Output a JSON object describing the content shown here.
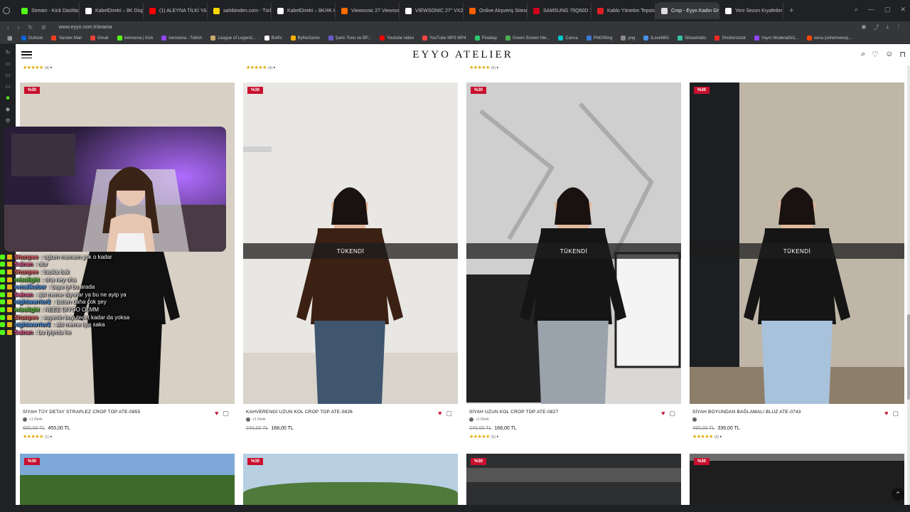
{
  "browser": {
    "tabs": [
      {
        "label": "Stream - Kick Dashboard",
        "color": "#53fc18"
      },
      {
        "label": "KabelDirekt – 8K DisplayP",
        "color": "#ffffff"
      },
      {
        "label": "(1) ALEYNA TİLKİ YALAN",
        "color": "#ff0000"
      },
      {
        "label": "sahibinden.com - Türkiye",
        "color": "#ffd800"
      },
      {
        "label": "KabelDirekt – 8K/4K HDMI",
        "color": "#ffffff"
      },
      {
        "label": "Viewsonic 27 Viewsonic",
        "color": "#ff6a00"
      },
      {
        "label": "VIEWSONIC 27\" VX2758",
        "color": "#ffffff"
      },
      {
        "label": "Online Alışveriş Sitesi, Tü",
        "color": "#ff6000"
      },
      {
        "label": "SAMSUNG 75Q60D 75 in",
        "color": "#d0021b"
      },
      {
        "label": "Kablo Yönetim Tepsisi M",
        "color": "#e01f26"
      },
      {
        "label": "Crop - Eyyo Kadın Giyim",
        "color": "#dddddd"
      },
      {
        "label": "Yeni Sezon Kıyafetler | Se",
        "color": "#ffffff"
      }
    ],
    "url": "www.eyyo.com.tr/arama",
    "bookmarks": [
      {
        "label": "Outlook",
        "color": "#0a64d6"
      },
      {
        "label": "Yandex Mail",
        "color": "#fc3f1d"
      },
      {
        "label": "Gmail",
        "color": "#ea4335"
      },
      {
        "label": "iremxena | Kick",
        "color": "#53fc18"
      },
      {
        "label": "iremxena - Twitch",
        "color": "#9146ff"
      },
      {
        "label": "League of Legend...",
        "color": "#c8aa6e"
      },
      {
        "label": "Botfix",
        "color": "#ffffff"
      },
      {
        "label": "ByNoGame",
        "color": "#ffb000"
      },
      {
        "label": "Şarkı Tonu ve BP...",
        "color": "#6a5acd"
      },
      {
        "label": "Youtube video",
        "color": "#ff0000"
      },
      {
        "label": "YouTube MP3 MP4",
        "color": "#ff4444"
      },
      {
        "label": "Pixabay",
        "color": "#2ec66d"
      },
      {
        "label": "Green Screen Me...",
        "color": "#4caf50"
      },
      {
        "label": "Canva",
        "color": "#00c4cc"
      },
      {
        "label": "PNGWing",
        "color": "#3a7bd5"
      },
      {
        "label": "png",
        "color": "#888888"
      },
      {
        "label": "iLoveIMG",
        "color": "#4a90e2"
      },
      {
        "label": "Streamlabs",
        "color": "#31c3a2"
      },
      {
        "label": "Shutterstock",
        "color": "#ee2b24"
      },
      {
        "label": "Yayın Moderatörü...",
        "color": "#9146ff"
      },
      {
        "label": "xena (u/iremxena)...",
        "color": "#ff4500"
      }
    ]
  },
  "site": {
    "logo": "EYYO ATELIER",
    "prev_row": [
      {
        "stars": "★★★★★",
        "count": "(4)"
      },
      {
        "stars": "★★★★★",
        "count": "(4)"
      },
      {
        "stars": "★★★★★",
        "count": "(5)"
      }
    ],
    "products": [
      {
        "badge": "%30",
        "name": "SİYAH TÜY DETAY STRAPLEZ CROP TOP ATE-0855",
        "swatch": "+1 Renk",
        "old_price": "650,00 TL",
        "new_price": "455,00 TL",
        "stars": "★★★★★",
        "count": "(1)",
        "sold_out": false,
        "sold_label": "",
        "bg": "#cfc9c1"
      },
      {
        "badge": "%30",
        "name": "KAHVERENGİ UZUN KOL CROP TOP ATE-0826",
        "swatch": "+1 Renk",
        "old_price": "240,00 TL",
        "new_price": "168,00 TL",
        "stars": "",
        "count": "",
        "sold_out": true,
        "sold_label": "TÜKENDİ",
        "bg": "#e9e7e3"
      },
      {
        "badge": "%30",
        "name": "SİYAH UZUN KOL CROP TOP ATE-0827",
        "swatch": "+1 Renk",
        "old_price": "240,00 TL",
        "new_price": "168,00 TL",
        "stars": "★★★★★",
        "count": "(5)",
        "sold_out": true,
        "sold_label": "TÜKENDİ",
        "bg": "#d9d8d6"
      },
      {
        "badge": "%30",
        "name": "SİYAH BOYUNDAN BAĞLAMALI BLUZ ATE-0743",
        "swatch": "",
        "old_price": "480,00 TL",
        "new_price": "336,00 TL",
        "stars": "★★★★★",
        "count": "(3)",
        "sold_out": true,
        "sold_label": "TÜKENDİ",
        "bg": "#bfb6a8"
      }
    ],
    "row2_badges": [
      "%30",
      "%30",
      "%30",
      "%30"
    ]
  },
  "overlay": {
    "chat": [
      {
        "user": "Shunpee",
        "color": "#ff6b6b",
        "text": ": oglum memem yok o kadar"
      },
      {
        "user": "Sainan",
        "color": "#ff5c9d",
        "text": ": olur"
      },
      {
        "user": "Shunpee",
        "color": "#ff6b6b",
        "text": ": baska bak"
      },
      {
        "user": "misolight",
        "color": "#6bdc4a",
        "text": ": oha ney oha"
      },
      {
        "user": "ismailkubur",
        "color": "#5aa9ff",
        "text": ": baya iyi bu arada"
      },
      {
        "user": "Sainan",
        "color": "#ff5c9d",
        "text": ": abi meme diyorlar ya bu ne ayip ya"
      },
      {
        "user": "nightwarrior2",
        "color": "#4fa3ff",
        "text": ": üstten daha çok şey"
      },
      {
        "user": "misolight",
        "color": "#6bdc4a",
        "text": ": NEEE DIYOO OLMM"
      },
      {
        "user": "Shunpee",
        "color": "#ff6b6b",
        "text": ": suyenin buyutecet kadar da yoksa"
      },
      {
        "user": "nightwarrior2",
        "color": "#4fa3ff",
        "text": ": abi meme işte saka"
      },
      {
        "user": "Sainan",
        "color": "#ff5c9d",
        "text": ": bu iyiymis he"
      }
    ]
  }
}
